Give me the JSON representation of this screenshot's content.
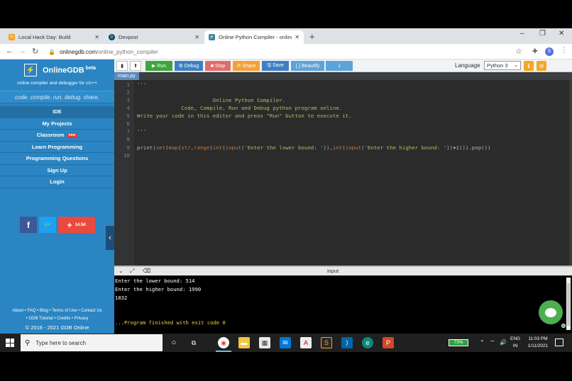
{
  "browser": {
    "tabs": [
      {
        "title": "Local Hack Day: Build",
        "favicon_color": "#f5a623"
      },
      {
        "title": "Devpost",
        "favicon_color": "#003e54"
      },
      {
        "title": "Online Python Compiler - online",
        "favicon_color": "#2a85c2"
      }
    ],
    "new_tab": "+",
    "window": {
      "minimize": "–",
      "maximize": "❐",
      "close": "✕"
    },
    "url_host": "onlinegdb.com",
    "url_path": "/online_python_compiler",
    "profile_initial": "S"
  },
  "sidebar": {
    "logo_icon": "⚡",
    "brand": "OnlineGDB",
    "beta": "beta",
    "tagline": "online compiler and debugger for c/c++",
    "motto": "code. compile. run. debug. share.",
    "menu": [
      {
        "label": "IDE",
        "active": true
      },
      {
        "label": "My Projects"
      },
      {
        "label": "Classroom",
        "badge": "new"
      },
      {
        "label": "Learn Programming"
      },
      {
        "label": "Programming Questions"
      },
      {
        "label": "Sign Up"
      },
      {
        "label": "Login"
      }
    ],
    "social": {
      "facebook": "f",
      "twitter": "t",
      "plus_count": "14.5K"
    },
    "footer_line1": "About • FAQ • Blog • Terms of Use • Contact Us",
    "footer_line2": "• GDB Tutorial • Credits • Privacy",
    "copyright": "© 2016 - 2021 GDB Online"
  },
  "toolbar": {
    "run": "▶ Run",
    "debug": "⚙ Debug",
    "stop": "■ Stop",
    "share": "⟳ Share",
    "save": "🖫 Save",
    "beautify": "{ } Beautify",
    "download": "⤓",
    "language_label": "Language",
    "language_value": "Python 3",
    "colors": {
      "run": "#3fa33f",
      "debug": "#3d7fc4",
      "stop": "#e06c6c",
      "share": "#f3a03a",
      "save": "#3d7fc4",
      "beautify": "#5ba3d8",
      "download": "#5ba3d8"
    }
  },
  "editor": {
    "file_tab": "main.py",
    "line_numbers": [
      "1",
      "2",
      "3",
      "4",
      "5",
      "6",
      "7",
      "8",
      "9",
      "10"
    ],
    "doc_open": "'''",
    "doc_line3": "                        Online Python Compiler.",
    "doc_line4": "              Code, Compile, Run and Debug python program online.",
    "doc_line5": "Write your code in this editor and press \"Run\" button to execute it.",
    "doc_close": "'''",
    "code_line9": {
      "p1": "print(",
      "k1": "set",
      "p2": "(",
      "k2": "map",
      "p3": "(",
      "k3": "str",
      "p4": ",",
      "k4": "range",
      "p5": "(",
      "k5": "int",
      "p6": "(",
      "k6": "input",
      "p7": "(",
      "s1": "'Enter the lower bound: '",
      "p8": ")),",
      "k7": "int",
      "p9": "(",
      "k8": "input",
      "p10": "(",
      "s2": "'Enter the higher bound: '",
      "p11": "))",
      "o1": "+",
      "n1": "1",
      "p12": "))).pop())"
    }
  },
  "console": {
    "title": "input",
    "lines": [
      "Enter the lower bound: 514",
      "Enter the higher bound: 1990",
      "1832",
      "",
      "",
      "...Program finished with exit code 0"
    ]
  },
  "taskbar": {
    "search_placeholder": "Type here to search",
    "battery": "73%",
    "lang_line1": "ENG",
    "lang_line2": "IN",
    "time": "11:03 PM",
    "date": "1/11/2021"
  }
}
